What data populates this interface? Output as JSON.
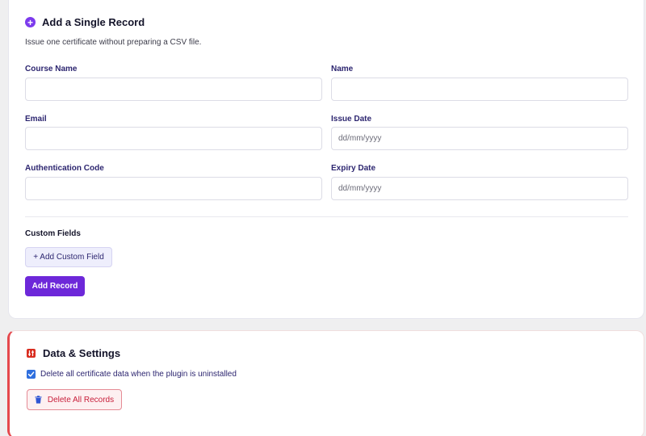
{
  "record_card": {
    "title": "Add a Single Record",
    "description": "Issue one certificate without preparing a CSV file.",
    "fields": {
      "course_name": {
        "label": "Course Name",
        "value": "",
        "placeholder": ""
      },
      "name": {
        "label": "Name",
        "value": "",
        "placeholder": ""
      },
      "email": {
        "label": "Email",
        "value": "",
        "placeholder": ""
      },
      "issue_date": {
        "label": "Issue Date",
        "value": "",
        "placeholder": "dd/mm/yyyy"
      },
      "authentication_code": {
        "label": "Authentication Code",
        "value": "",
        "placeholder": ""
      },
      "expiry_date": {
        "label": "Expiry Date",
        "value": "",
        "placeholder": "dd/mm/yyyy"
      }
    },
    "custom_fields_label": "Custom Fields",
    "add_custom_field_label": "+ Add Custom Field",
    "add_record_label": "Add Record"
  },
  "settings_card": {
    "title": "Data & Settings",
    "delete_on_uninstall_label": "Delete all certificate data when the plugin is uninstalled",
    "delete_on_uninstall_checked": true,
    "delete_all_label": "Delete All Records"
  },
  "colors": {
    "accent": "#6d28d9",
    "danger": "#e5484d",
    "checkbox": "#2f6fde"
  },
  "icons": {
    "record_title_icon": "plus-circle-icon",
    "settings_title_icon": "settings-sliders-icon",
    "checkbox_icon": "checkmark-icon",
    "delete_icon": "trash-icon"
  }
}
